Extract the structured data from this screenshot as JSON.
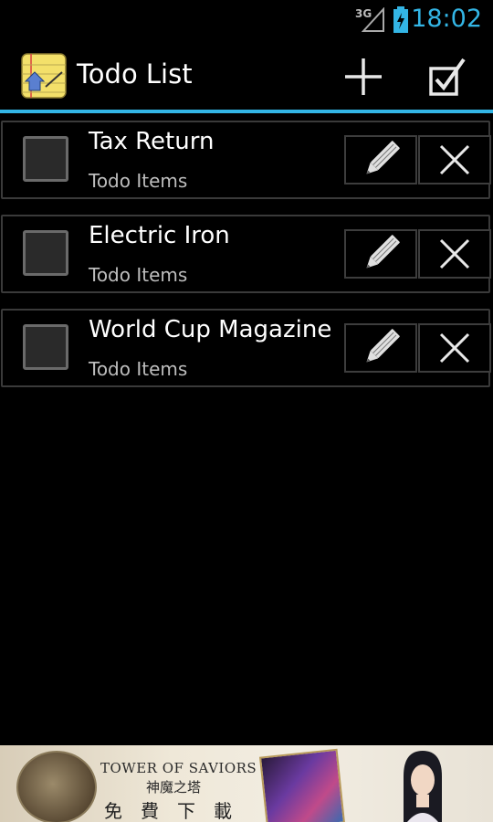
{
  "status_bar": {
    "network": "3G",
    "time": "18:02"
  },
  "action_bar": {
    "title": "Todo List",
    "add_icon": "plus-icon",
    "select_icon": "checkbox-checked-icon"
  },
  "todos": [
    {
      "title": "Tax Return",
      "category": "Todo Items",
      "checked": false
    },
    {
      "title": "Electric Iron",
      "category": "Todo Items",
      "checked": false
    },
    {
      "title": "World Cup Magazine",
      "category": "Todo Items",
      "checked": false
    }
  ],
  "ad": {
    "title": "TOWER OF SAVIORS",
    "subtitle": "神魔之塔",
    "cta": "免費下載"
  },
  "colors": {
    "accent": "#33b5e5",
    "background": "#000000",
    "row_border": "#3a3a3a"
  }
}
